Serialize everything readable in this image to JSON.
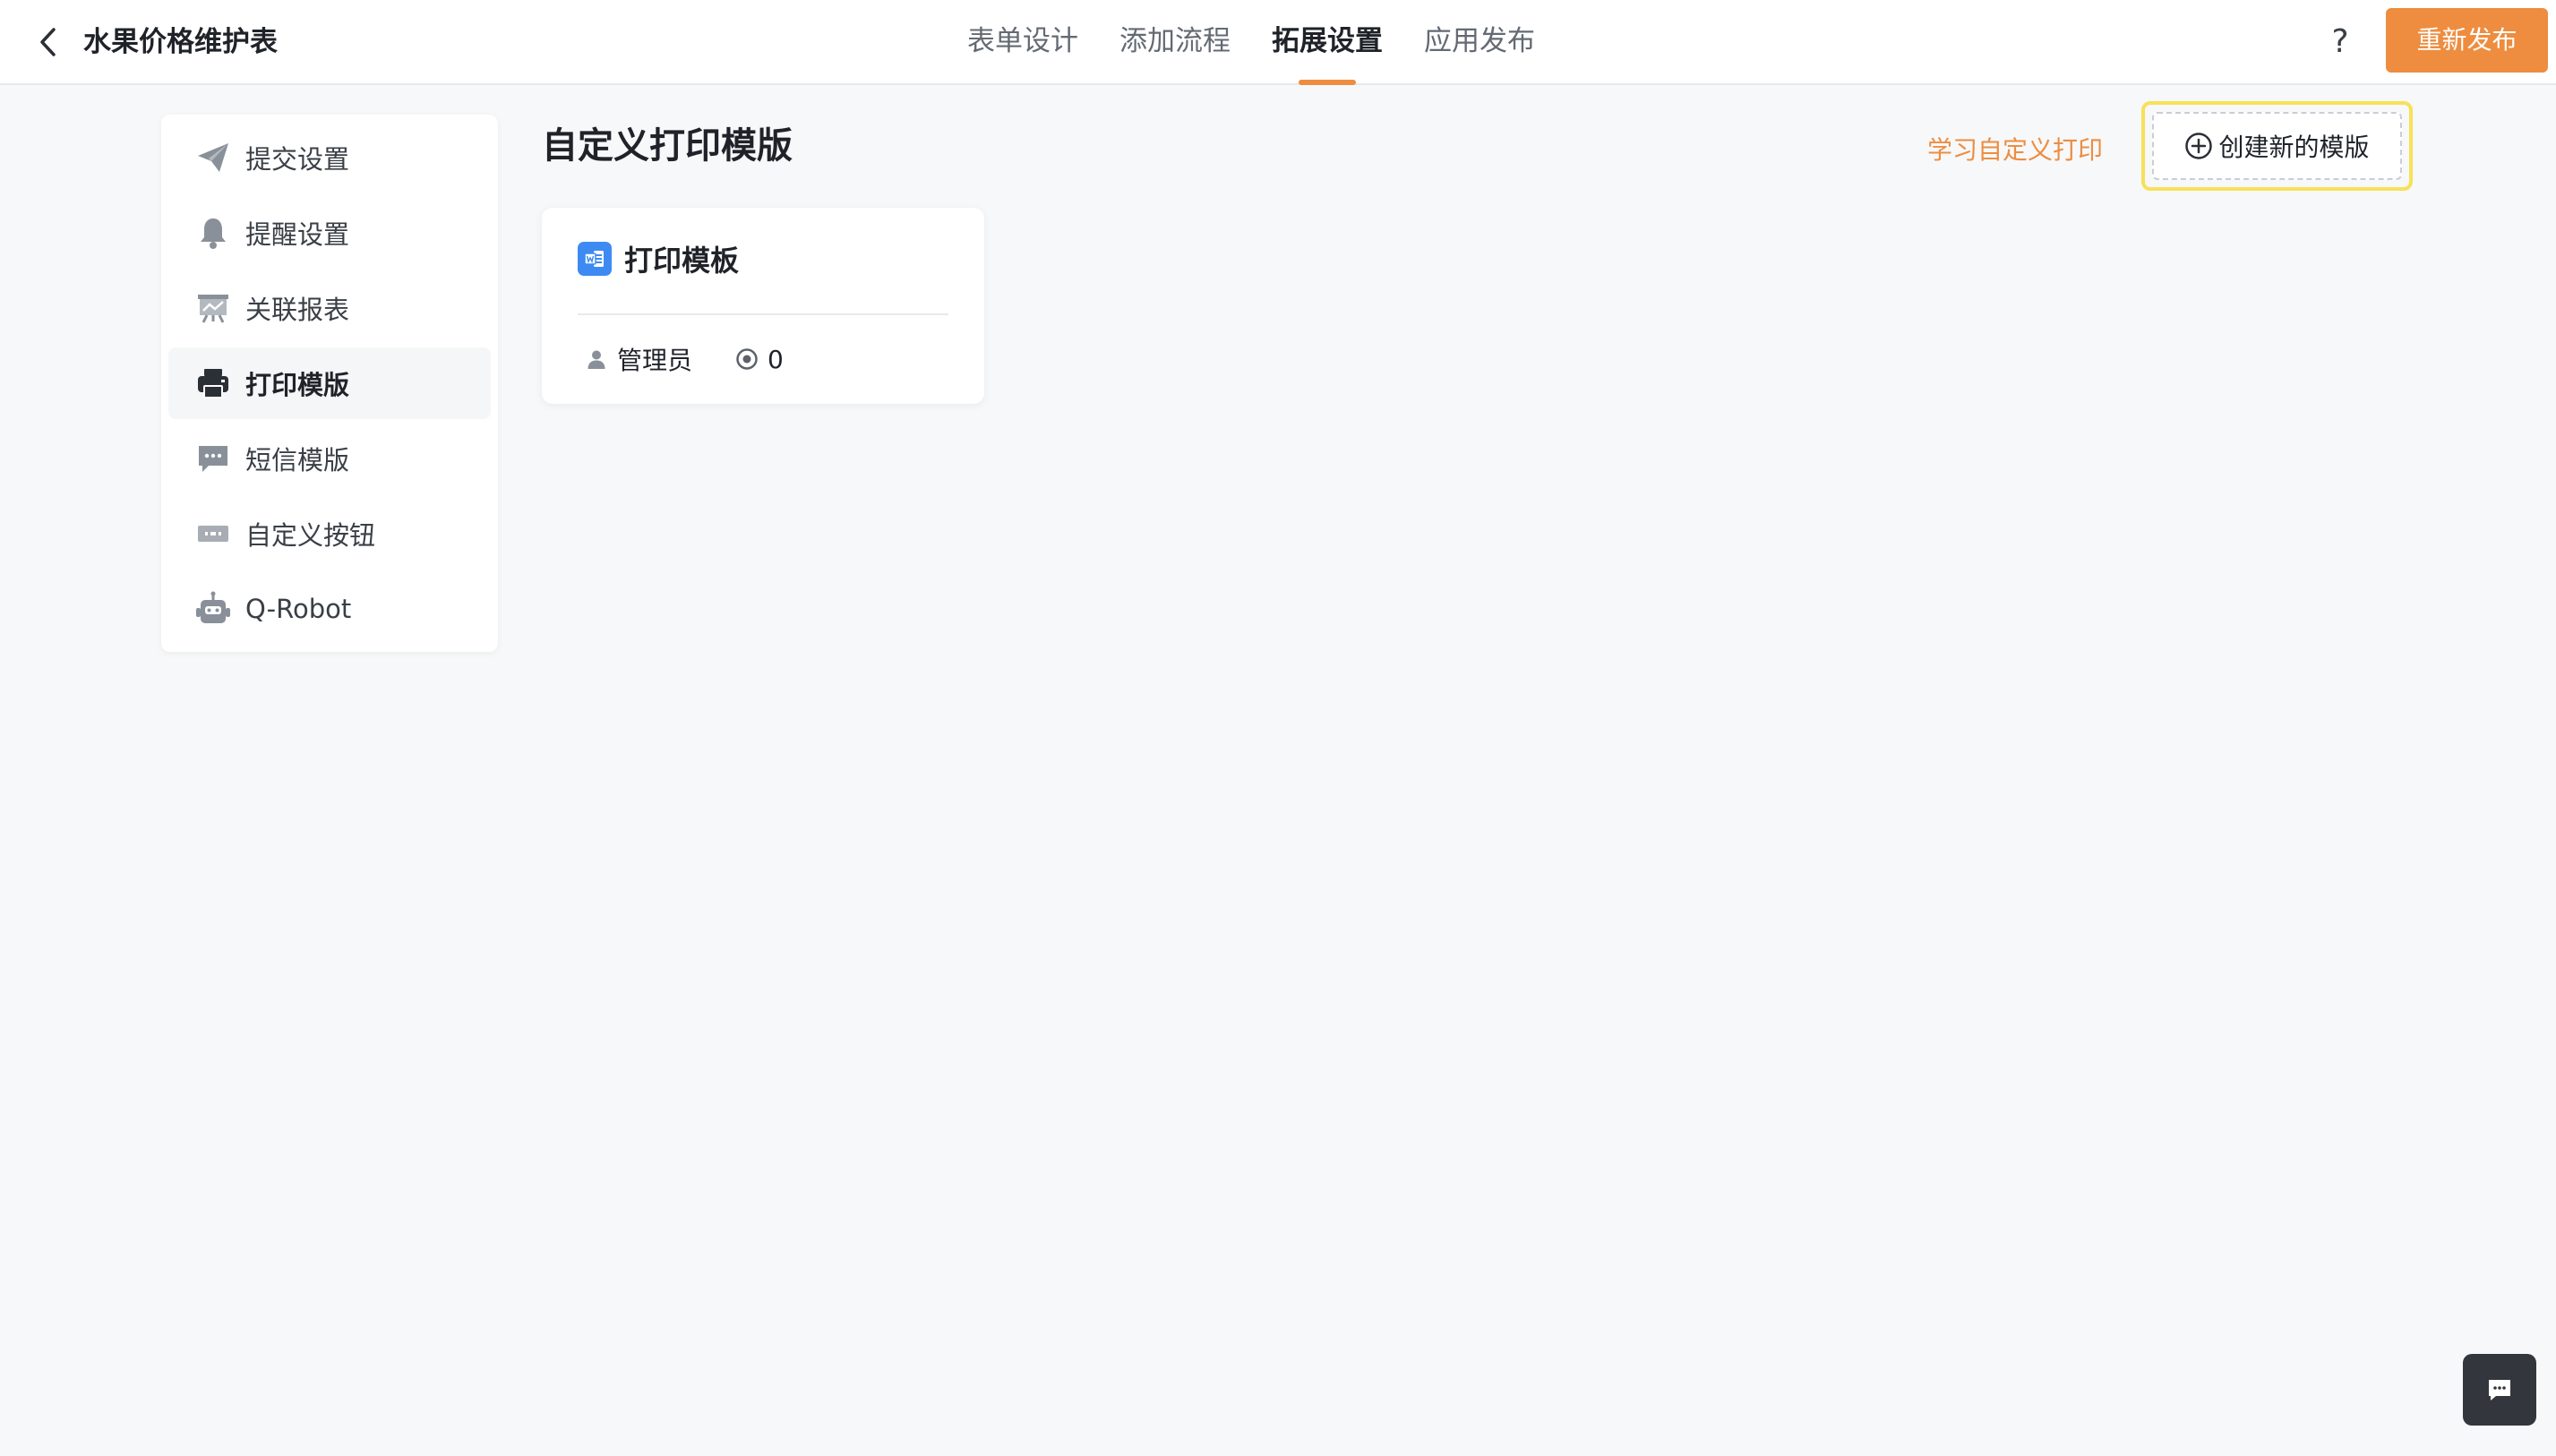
{
  "header": {
    "app_title": "水果价格维护表",
    "tabs": [
      {
        "label": "表单设计"
      },
      {
        "label": "添加流程"
      },
      {
        "label": "拓展设置",
        "active": true
      },
      {
        "label": "应用发布"
      }
    ],
    "help_label": "?",
    "republish_label": "重新发布"
  },
  "sidebar": {
    "items": [
      {
        "label": "提交设置",
        "icon": "paper-plane-icon"
      },
      {
        "label": "提醒设置",
        "icon": "bell-icon"
      },
      {
        "label": "关联报表",
        "icon": "report-board-icon"
      },
      {
        "label": "打印模版",
        "icon": "printer-icon",
        "active": true
      },
      {
        "label": "短信模版",
        "icon": "sms-bubble-icon"
      },
      {
        "label": "自定义按钮",
        "icon": "btn-icon"
      },
      {
        "label": "Q-Robot",
        "icon": "robot-icon"
      }
    ]
  },
  "main": {
    "title": "自定义打印模版",
    "learn_link": "学习自定义打印",
    "create_label": "创建新的模版",
    "card": {
      "title": "打印模板",
      "owner": "管理员",
      "count": "0"
    }
  },
  "colors": {
    "accent": "#ee8d3f",
    "highlight": "#f7e15a",
    "card_icon": "#3d8bf2"
  }
}
